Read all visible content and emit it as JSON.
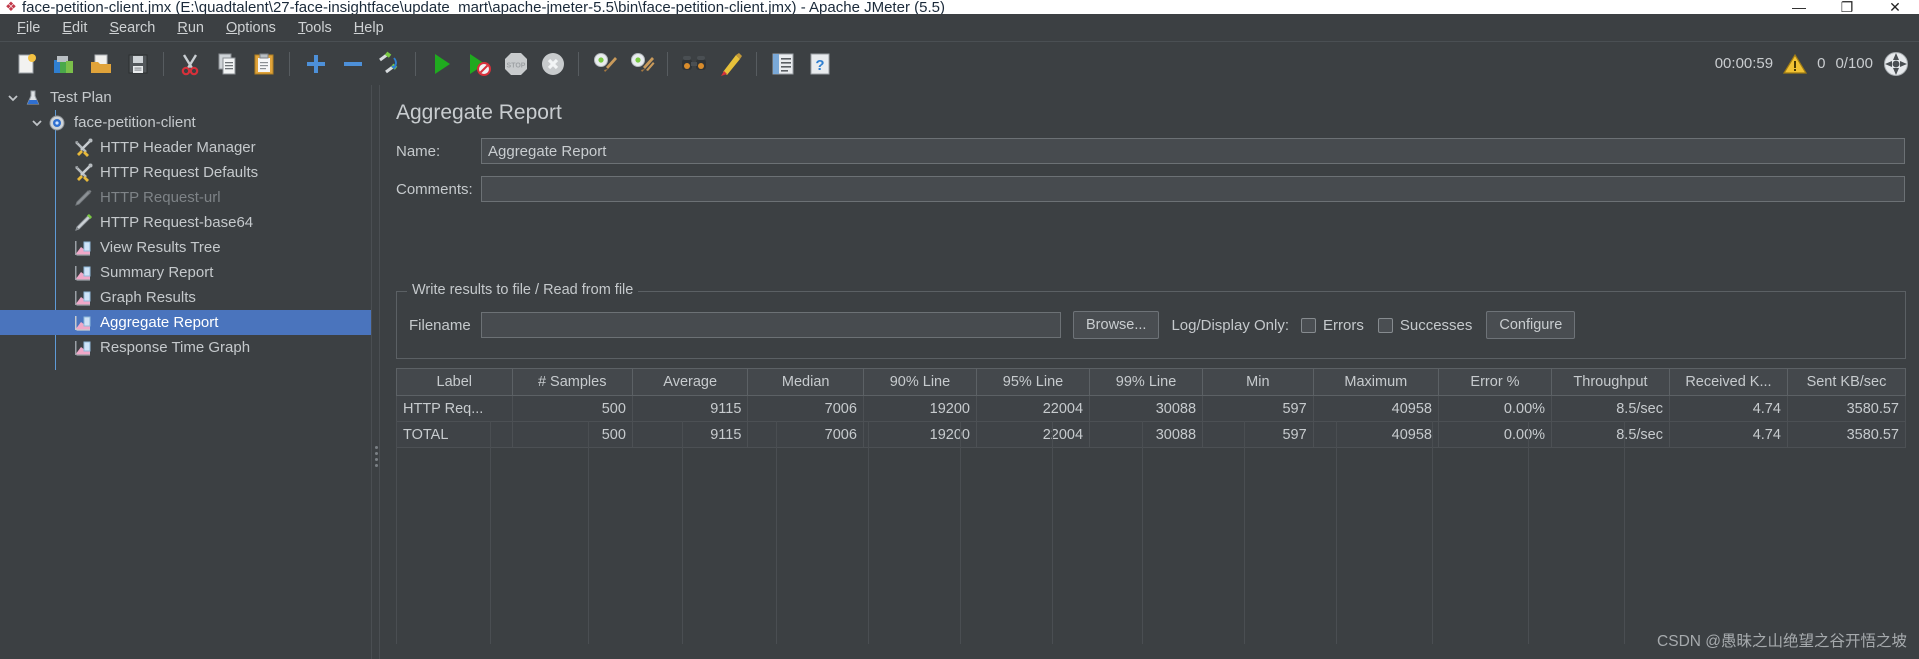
{
  "window": {
    "title": "face-petition-client.jmx (E:\\quadtalent\\27-face-insightface\\update_mart\\apache-jmeter-5.5\\bin\\face-petition-client.jmx) - Apache JMeter (5.5)",
    "app_icon": "jmeter-feather-icon",
    "minimize_label": "—",
    "maximize_label": "❐",
    "close_label": "✕"
  },
  "menubar": {
    "items": [
      {
        "label": "File",
        "mnemonic": "F"
      },
      {
        "label": "Edit",
        "mnemonic": "E"
      },
      {
        "label": "Search",
        "mnemonic": "S"
      },
      {
        "label": "Run",
        "mnemonic": "R"
      },
      {
        "label": "Options",
        "mnemonic": "O"
      },
      {
        "label": "Tools",
        "mnemonic": "T"
      },
      {
        "label": "Help",
        "mnemonic": "H"
      }
    ]
  },
  "toolbar": {
    "buttons": [
      {
        "name": "new-icon",
        "title": "New"
      },
      {
        "name": "templates-icon",
        "title": "Templates"
      },
      {
        "name": "open-icon",
        "title": "Open"
      },
      {
        "name": "save-icon",
        "title": "Save Test Plan"
      },
      {
        "name": "separator",
        "title": ""
      },
      {
        "name": "cut-icon",
        "title": "Cut"
      },
      {
        "name": "copy-icon",
        "title": "Copy"
      },
      {
        "name": "paste-icon",
        "title": "Paste"
      },
      {
        "name": "separator",
        "title": ""
      },
      {
        "name": "expand-all-icon",
        "title": "Expand All"
      },
      {
        "name": "collapse-all-icon",
        "title": "Collapse All"
      },
      {
        "name": "toggle-icon",
        "title": "Toggle"
      },
      {
        "name": "separator",
        "title": ""
      },
      {
        "name": "start-icon",
        "title": "Start"
      },
      {
        "name": "start-no-pauses-icon",
        "title": "Start no pauses"
      },
      {
        "name": "stop-icon",
        "title": "Stop"
      },
      {
        "name": "shutdown-icon",
        "title": "Shutdown"
      },
      {
        "name": "separator",
        "title": ""
      },
      {
        "name": "clear-icon",
        "title": "Clear"
      },
      {
        "name": "clear-all-icon",
        "title": "Clear All"
      },
      {
        "name": "separator",
        "title": ""
      },
      {
        "name": "search-icon",
        "title": "Search"
      },
      {
        "name": "search-reset-icon",
        "title": "Reset Search"
      },
      {
        "name": "separator",
        "title": ""
      },
      {
        "name": "function-helper-icon",
        "title": "Function Helper Dialog"
      },
      {
        "name": "help-icon",
        "title": "Help"
      }
    ],
    "status": {
      "elapsed_time": "00:00:59",
      "warning_icon": "warning-triangle-icon",
      "warning_count": "0",
      "threads_ratio": "0/100",
      "threads_icon": "thread-gauge-icon"
    }
  },
  "tree": {
    "nodes": [
      {
        "label": "Test Plan",
        "icon": "test-plan-flask-icon",
        "depth": 0,
        "twisty": "expanded",
        "state": "normal"
      },
      {
        "label": "face-petition-client",
        "icon": "thread-group-gear-icon",
        "depth": 1,
        "twisty": "expanded",
        "state": "normal"
      },
      {
        "label": "HTTP Header Manager",
        "icon": "config-tools-icon",
        "depth": 2,
        "twisty": "none",
        "state": "normal"
      },
      {
        "label": "HTTP Request Defaults",
        "icon": "config-tools-icon",
        "depth": 2,
        "twisty": "none",
        "state": "normal"
      },
      {
        "label": "HTTP Request-url",
        "icon": "sampler-pencil-icon",
        "depth": 2,
        "twisty": "none",
        "state": "disabled"
      },
      {
        "label": "HTTP Request-base64",
        "icon": "sampler-pencil-icon",
        "depth": 2,
        "twisty": "none",
        "state": "normal"
      },
      {
        "label": "View Results Tree",
        "icon": "listener-chart-icon",
        "depth": 2,
        "twisty": "none",
        "state": "normal"
      },
      {
        "label": "Summary Report",
        "icon": "listener-chart-icon",
        "depth": 2,
        "twisty": "none",
        "state": "normal"
      },
      {
        "label": "Graph Results",
        "icon": "listener-chart-icon",
        "depth": 2,
        "twisty": "none",
        "state": "normal"
      },
      {
        "label": "Aggregate Report",
        "icon": "listener-chart-icon",
        "depth": 2,
        "twisty": "none",
        "state": "selected"
      },
      {
        "label": "Response Time Graph",
        "icon": "listener-chart-icon",
        "depth": 2,
        "twisty": "none",
        "state": "normal"
      }
    ],
    "selection_color": "#4a74bd"
  },
  "main": {
    "panel_title": "Aggregate Report",
    "name_label": "Name:",
    "name_value": "Aggregate Report",
    "comments_label": "Comments:",
    "comments_value": "",
    "file_group_title": "Write results to file / Read from file",
    "filename_label": "Filename",
    "filename_value": "",
    "browse_label": "Browse...",
    "log_display_label": "Log/Display Only:",
    "errors_label": "Errors",
    "errors_checked": false,
    "successes_label": "Successes",
    "successes_checked": false,
    "configure_label": "Configure"
  },
  "table": {
    "columns": [
      "Label",
      "# Samples",
      "Average",
      "Median",
      "90% Line",
      "95% Line",
      "99% Line",
      "Min",
      "Maximum",
      "Error %",
      "Throughput",
      "Received K...",
      "Sent KB/sec"
    ],
    "rows": [
      {
        "cells": [
          "HTTP Req...",
          "500",
          "9115",
          "7006",
          "19200",
          "22004",
          "30088",
          "597",
          "40958",
          "0.00%",
          "8.5/sec",
          "4.74",
          "3580.57"
        ]
      },
      {
        "cells": [
          "TOTAL",
          "500",
          "9115",
          "7006",
          "19200",
          "22004",
          "30088",
          "597",
          "40958",
          "0.00%",
          "8.5/sec",
          "4.74",
          "3580.57"
        ]
      }
    ]
  },
  "watermark": {
    "text": "CSDN @愚昧之山绝望之谷开悟之坡"
  }
}
